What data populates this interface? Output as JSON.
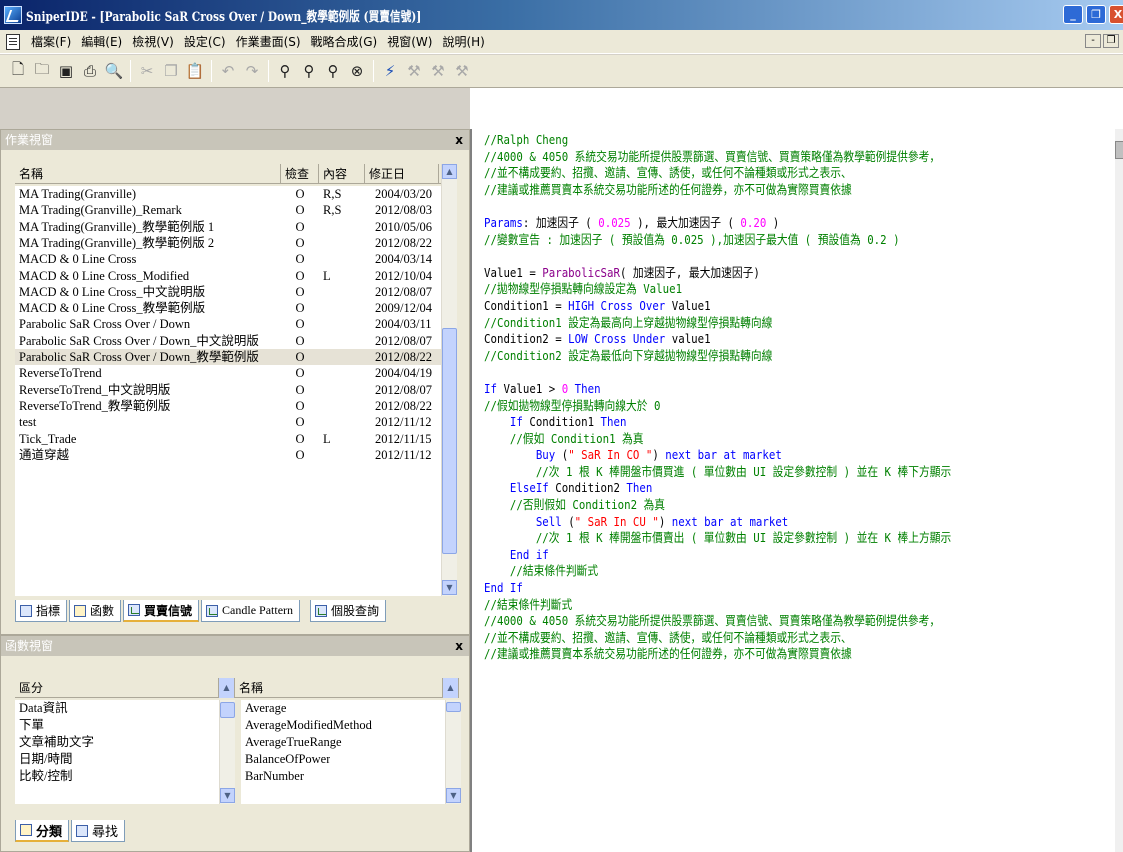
{
  "window": {
    "title": "SniperIDE - [Parabolic SaR Cross Over / Down_教學範例版 (買賣信號)]",
    "controls": {
      "minimize": "_",
      "maximize": "❐",
      "close": "X"
    }
  },
  "menu": {
    "items": [
      "檔案(F)",
      "編輯(E)",
      "檢視(V)",
      "設定(C)",
      "作業畫面(S)",
      "戰略合成(G)",
      "視窗(W)",
      "說明(H)"
    ],
    "mdi_controls": {
      "minimize": "-",
      "restore": "❐"
    }
  },
  "toolbar": {
    "icons": [
      "new-file-icon",
      "open-icon",
      "save-icon",
      "print-icon",
      "print-preview-icon",
      "cut-icon",
      "copy-icon",
      "paste-icon",
      "undo-icon",
      "redo-icon",
      "find-icon",
      "find-next-icon",
      "replace-icon",
      "binoculars-icon",
      "compile-icon",
      "indent-icon",
      "outdent-icon",
      "tools-icon"
    ]
  },
  "work_panel": {
    "title": "作業視窗",
    "close": "x",
    "columns": [
      "名稱",
      "檢查",
      "內容",
      "修正日"
    ],
    "rows": [
      {
        "name": "MA Trading(Granville)",
        "check": "O",
        "content": "R,S",
        "date": "2004/03/20"
      },
      {
        "name": "MA Trading(Granville)_Remark",
        "check": "O",
        "content": "R,S",
        "date": "2012/08/03"
      },
      {
        "name": "MA Trading(Granville)_教學範例版 1",
        "check": "O",
        "content": "",
        "date": "2010/05/06"
      },
      {
        "name": "MA Trading(Granville)_教學範例版 2",
        "check": "O",
        "content": "",
        "date": "2012/08/22"
      },
      {
        "name": "MACD & 0 Line Cross",
        "check": "O",
        "content": "",
        "date": "2004/03/14"
      },
      {
        "name": "MACD & 0 Line Cross_Modified",
        "check": "O",
        "content": "L",
        "date": "2012/10/04"
      },
      {
        "name": "MACD & 0 Line Cross_中文說明版",
        "check": "O",
        "content": "",
        "date": "2012/08/07"
      },
      {
        "name": "MACD & 0 Line Cross_教學範例版",
        "check": "O",
        "content": "",
        "date": "2009/12/04"
      },
      {
        "name": "Parabolic SaR Cross Over / Down",
        "check": "O",
        "content": "",
        "date": "2004/03/11"
      },
      {
        "name": "Parabolic SaR Cross Over / Down_中文說明版",
        "check": "O",
        "content": "",
        "date": "2012/08/07"
      },
      {
        "name": "Parabolic SaR Cross Over / Down_教學範例版",
        "check": "O",
        "content": "",
        "date": "2012/08/22"
      },
      {
        "name": "ReverseToTrend",
        "check": "O",
        "content": "",
        "date": "2004/04/19"
      },
      {
        "name": "ReverseToTrend_中文說明版",
        "check": "O",
        "content": "",
        "date": "2012/08/07"
      },
      {
        "name": "ReverseToTrend_教學範例版",
        "check": "O",
        "content": "",
        "date": "2012/08/22"
      },
      {
        "name": "test",
        "check": "O",
        "content": "",
        "date": "2012/11/12"
      },
      {
        "name": "Tick_Trade",
        "check": "O",
        "content": "L",
        "date": "2012/11/15"
      },
      {
        "name": "通道穿越",
        "check": "O",
        "content": "",
        "date": "2012/11/12"
      }
    ],
    "tabs": [
      "指標",
      "函數",
      "買賣信號",
      "Candle Pattern",
      "個股查詢"
    ],
    "active_tab": "買賣信號"
  },
  "func_panel": {
    "title": "函數視窗",
    "close": "x",
    "columns": [
      "區分",
      "名稱"
    ],
    "categories": [
      "Data資訊",
      "下單",
      "文章補助文字",
      "日期/時間",
      "比較/控制"
    ],
    "functions": [
      "Average",
      "AverageModifiedMethod",
      "AverageTrueRange",
      "BalanceOfPower",
      "BarNumber"
    ],
    "tabs": [
      "分類",
      "尋找"
    ]
  },
  "editor": {
    "lines": [
      [
        [
          "cm",
          "//Ralph Cheng"
        ]
      ],
      [
        [
          "cm",
          "//4000 & 4050 系統交易功能所提供股票篩選、買賣信號、買賣策略僅為教學範例提供參考，"
        ]
      ],
      [
        [
          "cm",
          "//並不構成要約、招攬、邀請、宣傳、誘使，或任何不論種類或形式之表示、"
        ]
      ],
      [
        [
          "cm",
          "//建議或推薦買賣本系統交易功能所述的任何證券，亦不可做為實際買賣依據"
        ]
      ],
      [],
      [
        [
          "kw",
          "Params"
        ],
        [
          "pl",
          ": 加速因子 ( "
        ],
        [
          "num",
          "0.025"
        ],
        [
          "pl",
          " ), 最大加速因子 ( "
        ],
        [
          "num",
          "0.20"
        ],
        [
          "pl",
          " )"
        ]
      ],
      [
        [
          "cm",
          "//變數宣告 : 加速因子 ( 預設值為 0.025 ),加速因子最大值 ( 預設值為 0.2 )"
        ]
      ],
      [],
      [
        [
          "pl",
          "Value1 = "
        ],
        [
          "fn",
          "ParabolicSaR"
        ],
        [
          "pl",
          "( 加速因子, 最大加速因子)"
        ]
      ],
      [
        [
          "cm",
          "//拋物線型停損點轉向線設定為 Value1"
        ]
      ],
      [
        [
          "pl",
          "Condition1 = "
        ],
        [
          "kw",
          "HIGH Cross Over"
        ],
        [
          "pl",
          " Value1"
        ]
      ],
      [
        [
          "cm",
          "//Condition1 設定為最高向上穿越拋物線型停損點轉向線"
        ]
      ],
      [
        [
          "pl",
          "Condition2 = "
        ],
        [
          "kw",
          "LOW Cross Under"
        ],
        [
          "pl",
          " value1"
        ]
      ],
      [
        [
          "cm",
          "//Condition2 設定為最低向下穿越拋物線型停損點轉向線"
        ]
      ],
      [],
      [
        [
          "kw",
          "If"
        ],
        [
          "pl",
          " Value1 > "
        ],
        [
          "num",
          "0"
        ],
        [
          "kw",
          " Then"
        ]
      ],
      [
        [
          "cm",
          "//假如拋物線型停損點轉向線大於 0"
        ]
      ],
      [
        [
          "pl",
          "    "
        ],
        [
          "kw",
          "If"
        ],
        [
          "pl",
          " Condition1 "
        ],
        [
          "kw",
          "Then"
        ]
      ],
      [
        [
          "pl",
          "    "
        ],
        [
          "cm",
          "//假如 Condition1 為真"
        ]
      ],
      [
        [
          "pl",
          "        "
        ],
        [
          "kw",
          "Buy"
        ],
        [
          "pl",
          " ("
        ],
        [
          "str",
          "\" SaR In CO \""
        ],
        [
          "pl",
          ") "
        ],
        [
          "kw",
          "next bar at market"
        ]
      ],
      [
        [
          "pl",
          "        "
        ],
        [
          "cm",
          "//次 1 根 K 棒開盤市價買進 ( 單位數由 UI 設定參數控制 ) 並在 K 棒下方顯示"
        ]
      ],
      [
        [
          "pl",
          "    "
        ],
        [
          "kw",
          "ElseIf"
        ],
        [
          "pl",
          " Condition2 "
        ],
        [
          "kw",
          "Then"
        ]
      ],
      [
        [
          "pl",
          "    "
        ],
        [
          "cm",
          "//否則假如 Condition2 為真"
        ]
      ],
      [
        [
          "pl",
          "        "
        ],
        [
          "kw",
          "Sell"
        ],
        [
          "pl",
          " ("
        ],
        [
          "str",
          "\" SaR In CU \""
        ],
        [
          "pl",
          ") "
        ],
        [
          "kw",
          "next bar at market"
        ]
      ],
      [
        [
          "pl",
          "        "
        ],
        [
          "cm",
          "//次 1 根 K 棒開盤市價賣出 ( 單位數由 UI 設定參數控制 ) 並在 K 棒上方顯示"
        ]
      ],
      [
        [
          "pl",
          "    "
        ],
        [
          "kw",
          "End if"
        ]
      ],
      [
        [
          "pl",
          "    "
        ],
        [
          "cm",
          "//結束條件判斷式"
        ]
      ],
      [
        [
          "kw",
          "End If"
        ]
      ],
      [
        [
          "cm",
          "//結束條件判斷式"
        ]
      ],
      [
        [
          "cm",
          "//4000 & 4050 系統交易功能所提供股票篩選、買賣信號、買賣策略僅為教學範例提供參考，"
        ]
      ],
      [
        [
          "cm",
          "//並不構成要約、招攬、邀請、宣傳、誘使，或任何不論種類或形式之表示、"
        ]
      ],
      [
        [
          "cm",
          "//建議或推薦買賣本系統交易功能所述的任何證券，亦不可做為實際買賣依據"
        ]
      ]
    ]
  }
}
